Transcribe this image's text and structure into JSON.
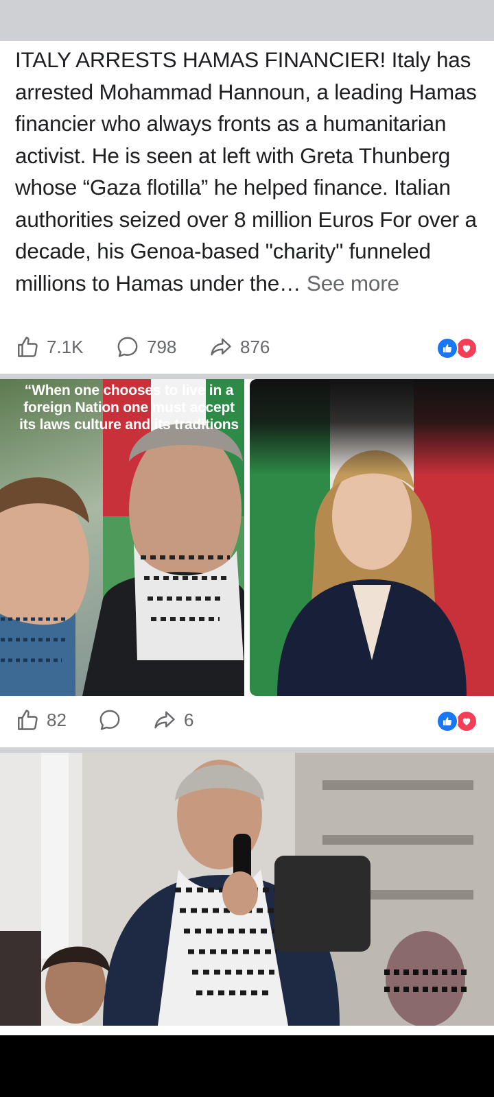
{
  "post1": {
    "text": "ITALY ARRESTS HAMAS FINANCIER! Italy has arrested Mohammad Hannoun, a leading Hamas financier who always fronts as a humanitarian activist. He is seen at left with Greta Thunberg whose “Gaza flotilla” he helped finance. Italian authorities seized over 8 million Euros For over a decade, his Genoa-based \"charity\" funneled millions to Hamas under the… ",
    "see_more": "See more",
    "likes": "7.1K",
    "comments": "798",
    "shares": "876"
  },
  "post2": {
    "quote": "“When one chooses to live in a\nforeign Nation one must accept\nits laws culture and its traditions",
    "likes": "82",
    "comments": "",
    "shares": "6"
  },
  "icons": {
    "like": "thumbs-up-icon",
    "comment": "comment-bubble-icon",
    "share": "share-arrow-icon",
    "reaction_like": "like-reaction-icon",
    "reaction_love": "love-reaction-icon"
  },
  "colors": {
    "like_blue": "#1877f2",
    "love_red": "#f33e58",
    "meta_gray": "#65676b"
  }
}
